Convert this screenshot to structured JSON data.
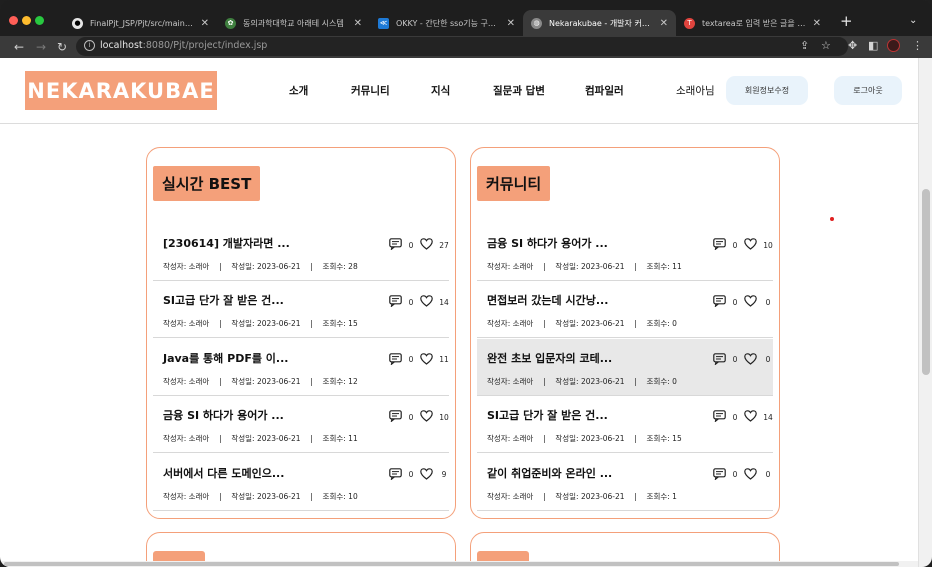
{
  "browser": {
    "tabs": [
      {
        "title": "FinalPjt_JSP/Pjt/src/main/webapp",
        "favicon": "github-icon",
        "active": false
      },
      {
        "title": "동의과학대학교 아래테 시스템",
        "favicon": "school-icon",
        "active": false
      },
      {
        "title": "OKKY - 간단한 sso기능 구현 방법",
        "favicon": "okky-icon",
        "active": false
      },
      {
        "title": "Nekarakubae - 개발자 커뮤니티",
        "favicon": "globe-icon",
        "active": true
      },
      {
        "title": "textarea로 입력 받은 글을 공백과 줄",
        "favicon": "t-icon",
        "active": false
      }
    ],
    "url_host": "localhost",
    "url_rest": ":8080/Pjt/project/index.jsp"
  },
  "site": {
    "logo": "NEKARAKUBAE",
    "nav": [
      "소개",
      "커뮤니티",
      "지식",
      "질문과 답변",
      "컴파일러"
    ],
    "user": "소래아님",
    "edit_button": "회원정보수정",
    "logout_button": "로그아웃"
  },
  "sections": [
    {
      "title": "실시간 BEST",
      "posts": [
        {
          "title": "[230614] 개발자라면 ...",
          "comments": "0",
          "likes": "27",
          "author_label": "작성자:",
          "author": "소래아",
          "date_label": "작성일:",
          "date": "2023-06-21",
          "views_label": "조회수:",
          "views": "28",
          "highlight": false
        },
        {
          "title": "SI고급 단가 잘 받은 건...",
          "comments": "0",
          "likes": "14",
          "author_label": "작성자:",
          "author": "소래아",
          "date_label": "작성일:",
          "date": "2023-06-21",
          "views_label": "조회수:",
          "views": "15",
          "highlight": false
        },
        {
          "title": "Java를 통해 PDF를 이...",
          "comments": "0",
          "likes": "11",
          "author_label": "작성자:",
          "author": "소래아",
          "date_label": "작성일:",
          "date": "2023-06-21",
          "views_label": "조회수:",
          "views": "12",
          "highlight": false
        },
        {
          "title": "금융 SI 하다가 용어가 ...",
          "comments": "0",
          "likes": "10",
          "author_label": "작성자:",
          "author": "소래아",
          "date_label": "작성일:",
          "date": "2023-06-21",
          "views_label": "조회수:",
          "views": "11",
          "highlight": false
        },
        {
          "title": "서버에서 다른 도메인으...",
          "comments": "0",
          "likes": "9",
          "author_label": "작성자:",
          "author": "소래아",
          "date_label": "작성일:",
          "date": "2023-06-21",
          "views_label": "조회수:",
          "views": "10",
          "highlight": false
        }
      ]
    },
    {
      "title": "커뮤니티",
      "posts": [
        {
          "title": "금융 SI 하다가 용어가 ...",
          "comments": "0",
          "likes": "10",
          "author_label": "작성자:",
          "author": "소래아",
          "date_label": "작성일:",
          "date": "2023-06-21",
          "views_label": "조회수:",
          "views": "11",
          "highlight": false
        },
        {
          "title": "면접보러 갔는데 시간낭...",
          "comments": "0",
          "likes": "0",
          "author_label": "작성자:",
          "author": "소래아",
          "date_label": "작성일:",
          "date": "2023-06-21",
          "views_label": "조회수:",
          "views": "0",
          "highlight": false
        },
        {
          "title": "완전 초보 입문자의 코테...",
          "comments": "0",
          "likes": "0",
          "author_label": "작성자:",
          "author": "소래아",
          "date_label": "작성일:",
          "date": "2023-06-21",
          "views_label": "조회수:",
          "views": "0",
          "highlight": true
        },
        {
          "title": "SI고급 단가 잘 받은 건...",
          "comments": "0",
          "likes": "14",
          "author_label": "작성자:",
          "author": "소래아",
          "date_label": "작성일:",
          "date": "2023-06-21",
          "views_label": "조회수:",
          "views": "15",
          "highlight": false
        },
        {
          "title": "같이 취업준비와 온라인 ...",
          "comments": "0",
          "likes": "0",
          "author_label": "작성자:",
          "author": "소래아",
          "date_label": "작성일:",
          "date": "2023-06-21",
          "views_label": "조회수:",
          "views": "1",
          "highlight": false
        }
      ]
    }
  ],
  "colors": {
    "accent": "#f4a07a",
    "highlight_row": "#e8e8e8",
    "pill_bg": "#e9f3fb"
  }
}
